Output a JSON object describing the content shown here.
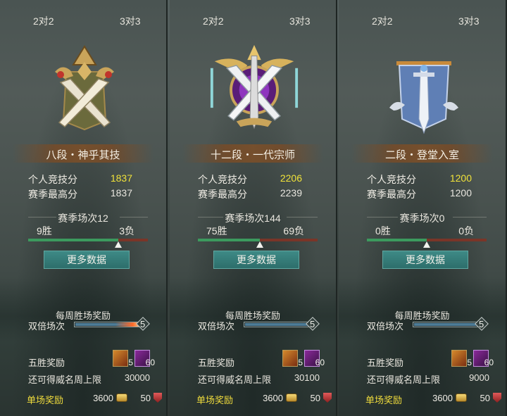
{
  "mode_tabs": {
    "two_v_two": "2对2",
    "three_v_three": "3对3"
  },
  "labels": {
    "personal_score": "个人竞技分",
    "season_high": "赛季最高分",
    "more_data": "更多数据",
    "weekly_reward": "每周胜场奖励",
    "double_matches": "双倍场次",
    "five_win_reward": "五胜奖励",
    "fame_cap": "还可得威名周上限",
    "single_reward": "单场奖励"
  },
  "panels": [
    {
      "rank": "八段・神乎其技",
      "score": "1837",
      "season_high": "1837",
      "season_matches": "赛季场次12",
      "wins": "9胜",
      "losses": "3负",
      "win_ratio": 0.75,
      "double_count": "5",
      "double_fill": 1.0,
      "item1_count": "5",
      "item2_count": "60",
      "fame_cap": "30000",
      "coin": "3600",
      "rep": "50",
      "emblem": "crossed-swords-gold-emblem-icon"
    },
    {
      "rank": "十二段・一代宗师",
      "score": "2206",
      "season_high": "2239",
      "season_matches": "赛季场次144",
      "wins": "75胜",
      "losses": "69负",
      "win_ratio": 0.52,
      "double_count": "5",
      "double_fill": 1.0,
      "item1_count": "5",
      "item2_count": "60",
      "fame_cap": "30100",
      "coin": "3600",
      "rep": "50",
      "emblem": "grandmaster-purple-emblem-icon"
    },
    {
      "rank": "二段・登堂入室",
      "score": "1200",
      "season_high": "1200",
      "season_matches": "赛季场次0",
      "wins": "0胜",
      "losses": "0负",
      "win_ratio": 0.5,
      "double_count": "5",
      "double_fill": 1.0,
      "item1_count": "5",
      "item2_count": "60",
      "fame_cap": "9000",
      "coin": "3600",
      "rep": "50",
      "emblem": "sword-banner-blue-emblem-icon"
    }
  ]
}
